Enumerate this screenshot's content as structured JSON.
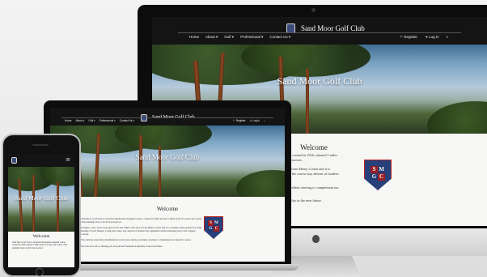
{
  "site": {
    "title": "Sand Moor Golf Club",
    "hero_title": "Sand Moor Golf Club",
    "welcome_heading": "Welcome"
  },
  "nav": {
    "items": [
      "Home",
      "About ▾",
      "Golf ▾",
      "Professional ▾",
      "Contact Us ▾"
    ],
    "register": "Register",
    "login": "Log In",
    "search_icon": "search-icon"
  },
  "logo_letters": [
    "S",
    "M",
    "G",
    "C"
  ],
  "desktop_text": {
    "line1": "course, created in 1926, situated 5 miles",
    "line2": "ating reservoir.",
    "line3": "advice from Henry Cotton and it is",
    "line4": "to help the course stay abreast of modern",
    "line5": "ncept.",
    "line6": "has excellent catering to complement our",
    "line7": "hospitality in the near future."
  },
  "laptop_text": {
    "p1": "Sand Moor Golf Club is an Alister MacKenzie designed course, created in 1926, situated 5 miles north of Leeds City Centre, with stunning views over Eccup reservoir.",
    "p2": "Changes to the course took place in the late 1960's with advice from Henry Cotton and it is currently being updated by Andy Keeling of Golf Design, to help the course stay abreast of modern day equipment whilst remaining true to the original concept.",
    "p3": "The club has been fully refurbished in recent years and has excellent catering to complement our fantastic course.",
    "p4": "We look forward to offering you exceptional Yorkshire hospitality in the near future."
  },
  "phone_text": {
    "p1": "Sand Moor Golf Club is an Alister MacKenzie designed course, created in 1926, situated 5 miles north of Leeds City Centre, with stunning views over Eccup reservoir."
  },
  "colors": {
    "header": "#141414",
    "crest_red": "#9b1d24",
    "crest_blue": "#233a73"
  }
}
